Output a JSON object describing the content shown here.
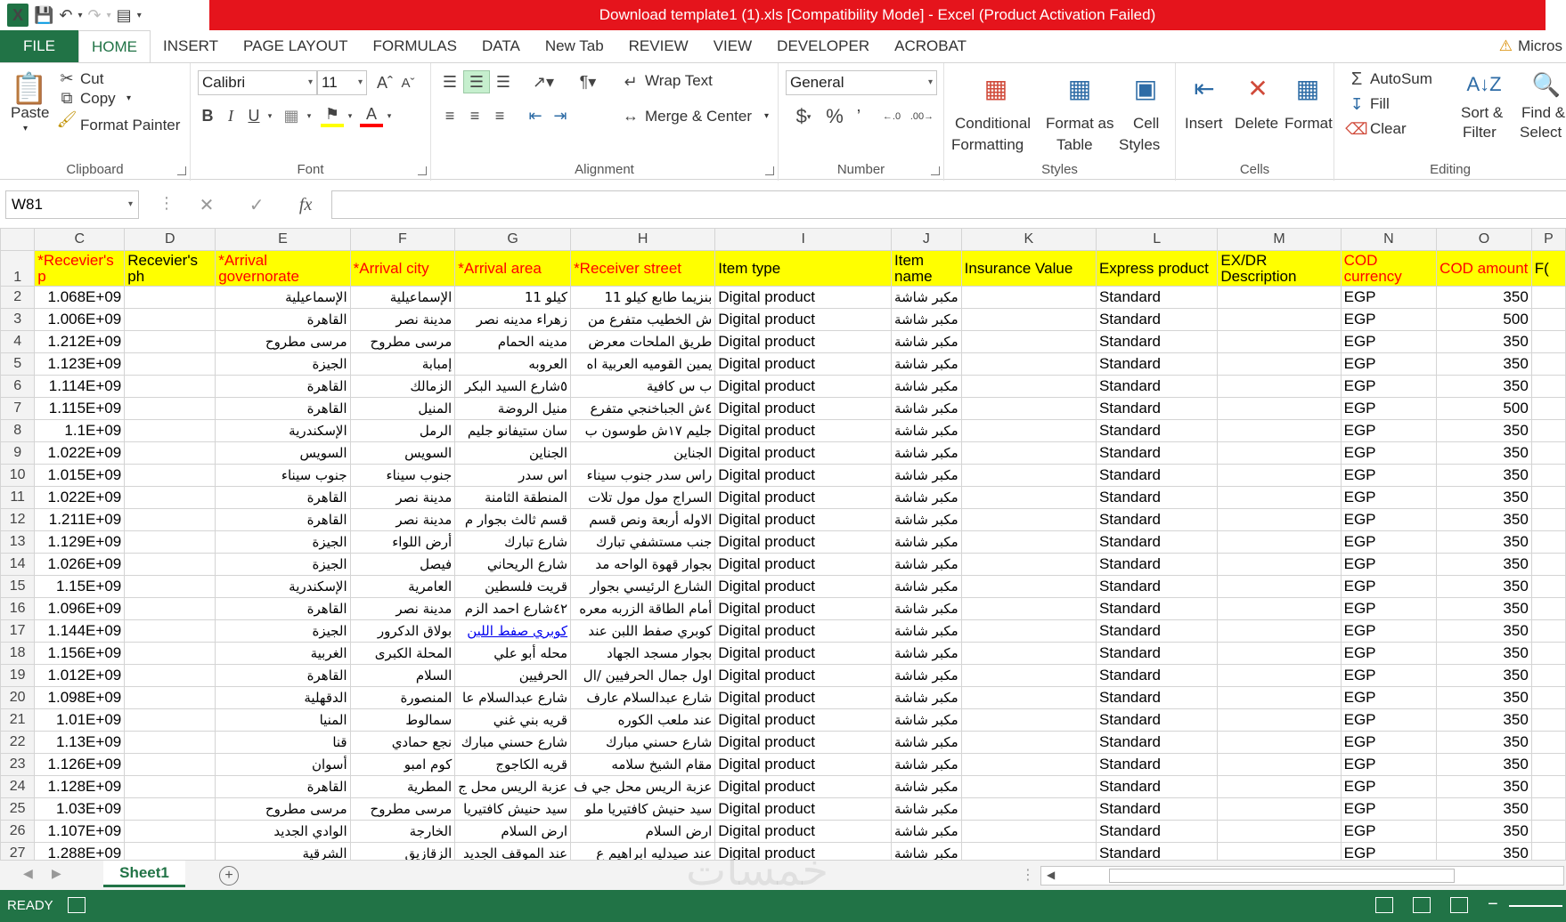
{
  "window": {
    "title": "Download template1 (1).xls  [Compatibility Mode] -  Excel (Product Activation Failed)"
  },
  "tabs": [
    "FILE",
    "HOME",
    "INSERT",
    "PAGE LAYOUT",
    "FORMULAS",
    "DATA",
    "New Tab",
    "REVIEW",
    "VIEW",
    "DEVELOPER",
    "ACROBAT"
  ],
  "account_label": "Micros",
  "ribbon": {
    "clipboard": {
      "paste": "Paste",
      "cut": "Cut",
      "copy": "Copy",
      "format_painter": "Format Painter",
      "label": "Clipboard"
    },
    "font": {
      "name": "Calibri",
      "size": "11",
      "label": "Font"
    },
    "alignment": {
      "wrap": "Wrap Text",
      "merge": "Merge & Center",
      "label": "Alignment"
    },
    "number": {
      "format": "General",
      "label": "Number"
    },
    "styles": {
      "cond1": "Conditional",
      "cond2": "Formatting",
      "fmt1": "Format as",
      "fmt2": "Table",
      "cell1": "Cell",
      "cell2": "Styles",
      "label": "Styles"
    },
    "cells": {
      "insert": "Insert",
      "delete": "Delete",
      "format": "Format",
      "label": "Cells"
    },
    "editing": {
      "autosum": "AutoSum",
      "fill": "Fill",
      "clear": "Clear",
      "sort1": "Sort &",
      "sort2": "Filter",
      "find1": "Find &",
      "find2": "Select",
      "label": "Editing"
    }
  },
  "formula_bar": {
    "name_box": "W81",
    "fx": "fx"
  },
  "columns": [
    "C",
    "D",
    "E",
    "F",
    "G",
    "H",
    "I",
    "J",
    "K",
    "L",
    "M",
    "N",
    "O",
    "P"
  ],
  "headers": [
    "*Recevier's p",
    "Recevier's ph",
    "*Arrival governorate",
    "*Arrival city",
    "*Arrival area",
    "*Receiver street",
    "Item type",
    "Item name",
    "Insurance Value",
    "Express product",
    "EX/DR Description",
    "COD currency",
    "COD amount",
    "F("
  ],
  "rows": [
    {
      "n": "2",
      "c": "1.068E+09",
      "e": "الإسماعيلية",
      "f": "الإسماعيلية",
      "g": "كيلو 11",
      "h": "بنزيما طابع كيلو 11",
      "o": "350"
    },
    {
      "n": "3",
      "c": "1.006E+09",
      "e": "القاهرة",
      "f": "مدينة نصر",
      "g": "زهراء مدينه نصر",
      "h": "ش الخطيب متفرع من",
      "o": "500"
    },
    {
      "n": "4",
      "c": "1.212E+09",
      "e": "مرسى مطروح",
      "f": "مرسى مطروح",
      "g": "مدينه الحمام",
      "h": "طريق الملحات معرض",
      "o": "350"
    },
    {
      "n": "5",
      "c": "1.123E+09",
      "e": "الجيزة",
      "f": "إمبابة",
      "g": "العروبه",
      "h": "يمين القوميه العربية اه",
      "o": "350"
    },
    {
      "n": "6",
      "c": "1.114E+09",
      "e": "القاهرة",
      "f": "الزمالك",
      "g": "٥شارع السيد البكر",
      "h": "ب س كافية",
      "o": "350"
    },
    {
      "n": "7",
      "c": "1.115E+09",
      "e": "القاهرة",
      "f": "المنيل",
      "g": "منيل الروضة",
      "h": "٤ش الجباخنجي متفرع",
      "o": "500"
    },
    {
      "n": "8",
      "c": "1.1E+09",
      "e": "الإسكندرية",
      "f": "الرمل",
      "g": "سان ستيفانو جليم",
      "h": "جليم ١٧ش طوسون ب",
      "o": "350"
    },
    {
      "n": "9",
      "c": "1.022E+09",
      "e": "السويس",
      "f": "السويس",
      "g": "الجناين",
      "h": "الجناين",
      "o": "350"
    },
    {
      "n": "10",
      "c": "1.015E+09",
      "e": "جنوب سيناء",
      "f": "جنوب سيناء",
      "g": "اس سدر",
      "h": "راس سدر جنوب سيناء",
      "o": "350"
    },
    {
      "n": "11",
      "c": "1.022E+09",
      "e": "القاهرة",
      "f": "مدينة نصر",
      "g": "المنطقة الثامنة",
      "h": "السراج مول مول تلات",
      "o": "350"
    },
    {
      "n": "12",
      "c": "1.211E+09",
      "e": "القاهرة",
      "f": "مدينة نصر",
      "g": "قسم ثالث بجوار م",
      "h": "الاوله أربعة ونص قسم",
      "o": "350"
    },
    {
      "n": "13",
      "c": "1.129E+09",
      "e": "الجيزة",
      "f": "أرض اللواء",
      "g": "شارع تبارك",
      "h": "جنب مستشفي تبارك",
      "o": "350"
    },
    {
      "n": "14",
      "c": "1.026E+09",
      "e": "الجيزة",
      "f": "فيصل",
      "g": "شارع الريحاني",
      "h": "بجوار قهوة الواحه مد",
      "o": "350"
    },
    {
      "n": "15",
      "c": "1.15E+09",
      "e": "الإسكندرية",
      "f": "العامرية",
      "g": "قريت فلسطين",
      "h": "الشارع الرئيسي بجوار",
      "o": "350"
    },
    {
      "n": "16",
      "c": "1.096E+09",
      "e": "القاهرة",
      "f": "مدينة نصر",
      "g": "٤٢شارع احمد الزم",
      "h": "أمام الطاقة الزربه معره",
      "o": "350"
    },
    {
      "n": "17",
      "c": "1.144E+09",
      "e": "الجيزة",
      "f": "بولاق الدكرور",
      "g": "كوبري صفط اللبن",
      "h": "كوبري صفط اللبن عند",
      "o": "350",
      "link": true
    },
    {
      "n": "18",
      "c": "1.156E+09",
      "e": "الغربية",
      "f": "المحلة الكبرى",
      "g": "محله أبو علي",
      "h": "بجوار مسجد الجهاد",
      "o": "350"
    },
    {
      "n": "19",
      "c": "1.012E+09",
      "e": "القاهرة",
      "f": "السلام",
      "g": "الحرفيين",
      "h": "اول جمال الحرفيين /ال",
      "o": "350"
    },
    {
      "n": "20",
      "c": "1.098E+09",
      "e": "الدقهلية",
      "f": "المنصورة",
      "g": "شارع عبدالسلام عا",
      "h": "شارع عبدالسلام عارف",
      "o": "350"
    },
    {
      "n": "21",
      "c": "1.01E+09",
      "e": "المنيا",
      "f": "سمالوط",
      "g": "قريه بني غني",
      "h": "عند ملعب الكوره",
      "o": "350"
    },
    {
      "n": "22",
      "c": "1.13E+09",
      "e": "قنا",
      "f": "نجع حمادي",
      "g": "شارع حسني مبارك",
      "h": "شارع حسني مبارك",
      "o": "350"
    },
    {
      "n": "23",
      "c": "1.126E+09",
      "e": "أسوان",
      "f": "كوم امبو",
      "g": "قريه الكاجوج",
      "h": "مقام الشيخ سلامه",
      "o": "350"
    },
    {
      "n": "24",
      "c": "1.128E+09",
      "e": "القاهرة",
      "f": "المطرية",
      "g": "عزبة الريس محل ج",
      "h": "عزبة الريس محل جي ف",
      "o": "350"
    },
    {
      "n": "25",
      "c": "1.03E+09",
      "e": "مرسى مطروح",
      "f": "مرسى مطروح",
      "g": "سيد حنيش كافتيريا",
      "h": "سيد حنيش كافتيريا ملو",
      "o": "350"
    },
    {
      "n": "26",
      "c": "1.107E+09",
      "e": "الوادي الجديد",
      "f": "الخارجة",
      "g": "ارض السلام",
      "h": "ارض السلام",
      "o": "350"
    },
    {
      "n": "27",
      "c": "1.288E+09",
      "e": "الشرقية",
      "f": "الزقازيق",
      "g": "عند الموقف الجديد",
      "h": "عند صيدليه ابراهيم ع",
      "o": "350"
    }
  ],
  "constants": {
    "item_type": "Digital product",
    "item_name": "مكبر شاشة",
    "express": "Standard",
    "currency": "EGP"
  },
  "sheet_tab": "Sheet1",
  "status": {
    "ready": "READY"
  },
  "colors": {
    "excel_green": "#217346",
    "title_red": "#e5141c",
    "header_yellow": "#ffff00",
    "required_red": "#ff0000"
  }
}
